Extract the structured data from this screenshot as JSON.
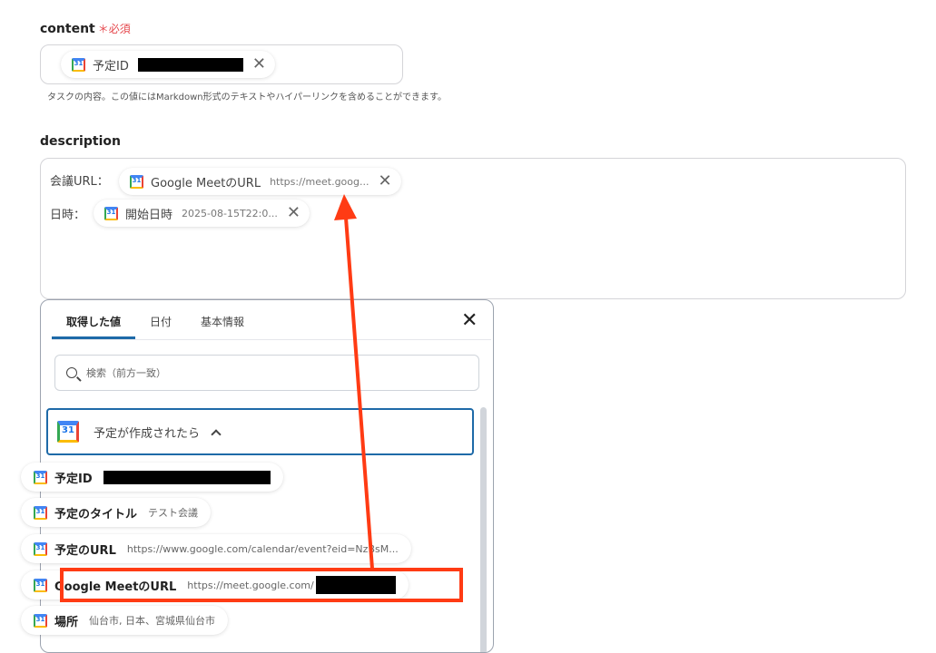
{
  "content_field": {
    "label": "content",
    "required_mark": "＊必須",
    "chip": {
      "label": "予定ID"
    },
    "help": "タスクの内容。この値にはMarkdown形式のテキストやハイパーリンクを含めることができます。"
  },
  "description_field": {
    "label": "description",
    "lines": [
      {
        "prefix": "会議URL：",
        "chip_label": "Google MeetのURL",
        "chip_value": "https://meet.goog..."
      },
      {
        "prefix": "日時：",
        "chip_label": "開始日時",
        "chip_value": "2025-08-15T22:0..."
      }
    ]
  },
  "panel": {
    "tabs": [
      "取得した値",
      "日付",
      "基本情報"
    ],
    "active_tab": "取得した値",
    "search_placeholder": "検索（前方一致）",
    "section_title": "予定が作成されたら",
    "items": [
      {
        "label": "予定ID",
        "value": ""
      },
      {
        "label": "予定のタイトル",
        "value": "テスト会議"
      },
      {
        "label": "予定のURL",
        "value": "https://www.google.com/calendar/event?eid=NzBsM..."
      },
      {
        "label": "Google MeetのURL",
        "value": "https://meet.google.com/"
      },
      {
        "label": "場所",
        "value": "仙台市, 日本、宮城県仙台市"
      }
    ]
  },
  "icons": {
    "calendar": "google-calendar-icon",
    "close": "close-icon",
    "search": "search-icon",
    "chevron": "chevron-up-icon"
  },
  "colors": {
    "accent": "#1e6aa8",
    "annotation": "#ff3b14",
    "required": "#e5484d"
  }
}
